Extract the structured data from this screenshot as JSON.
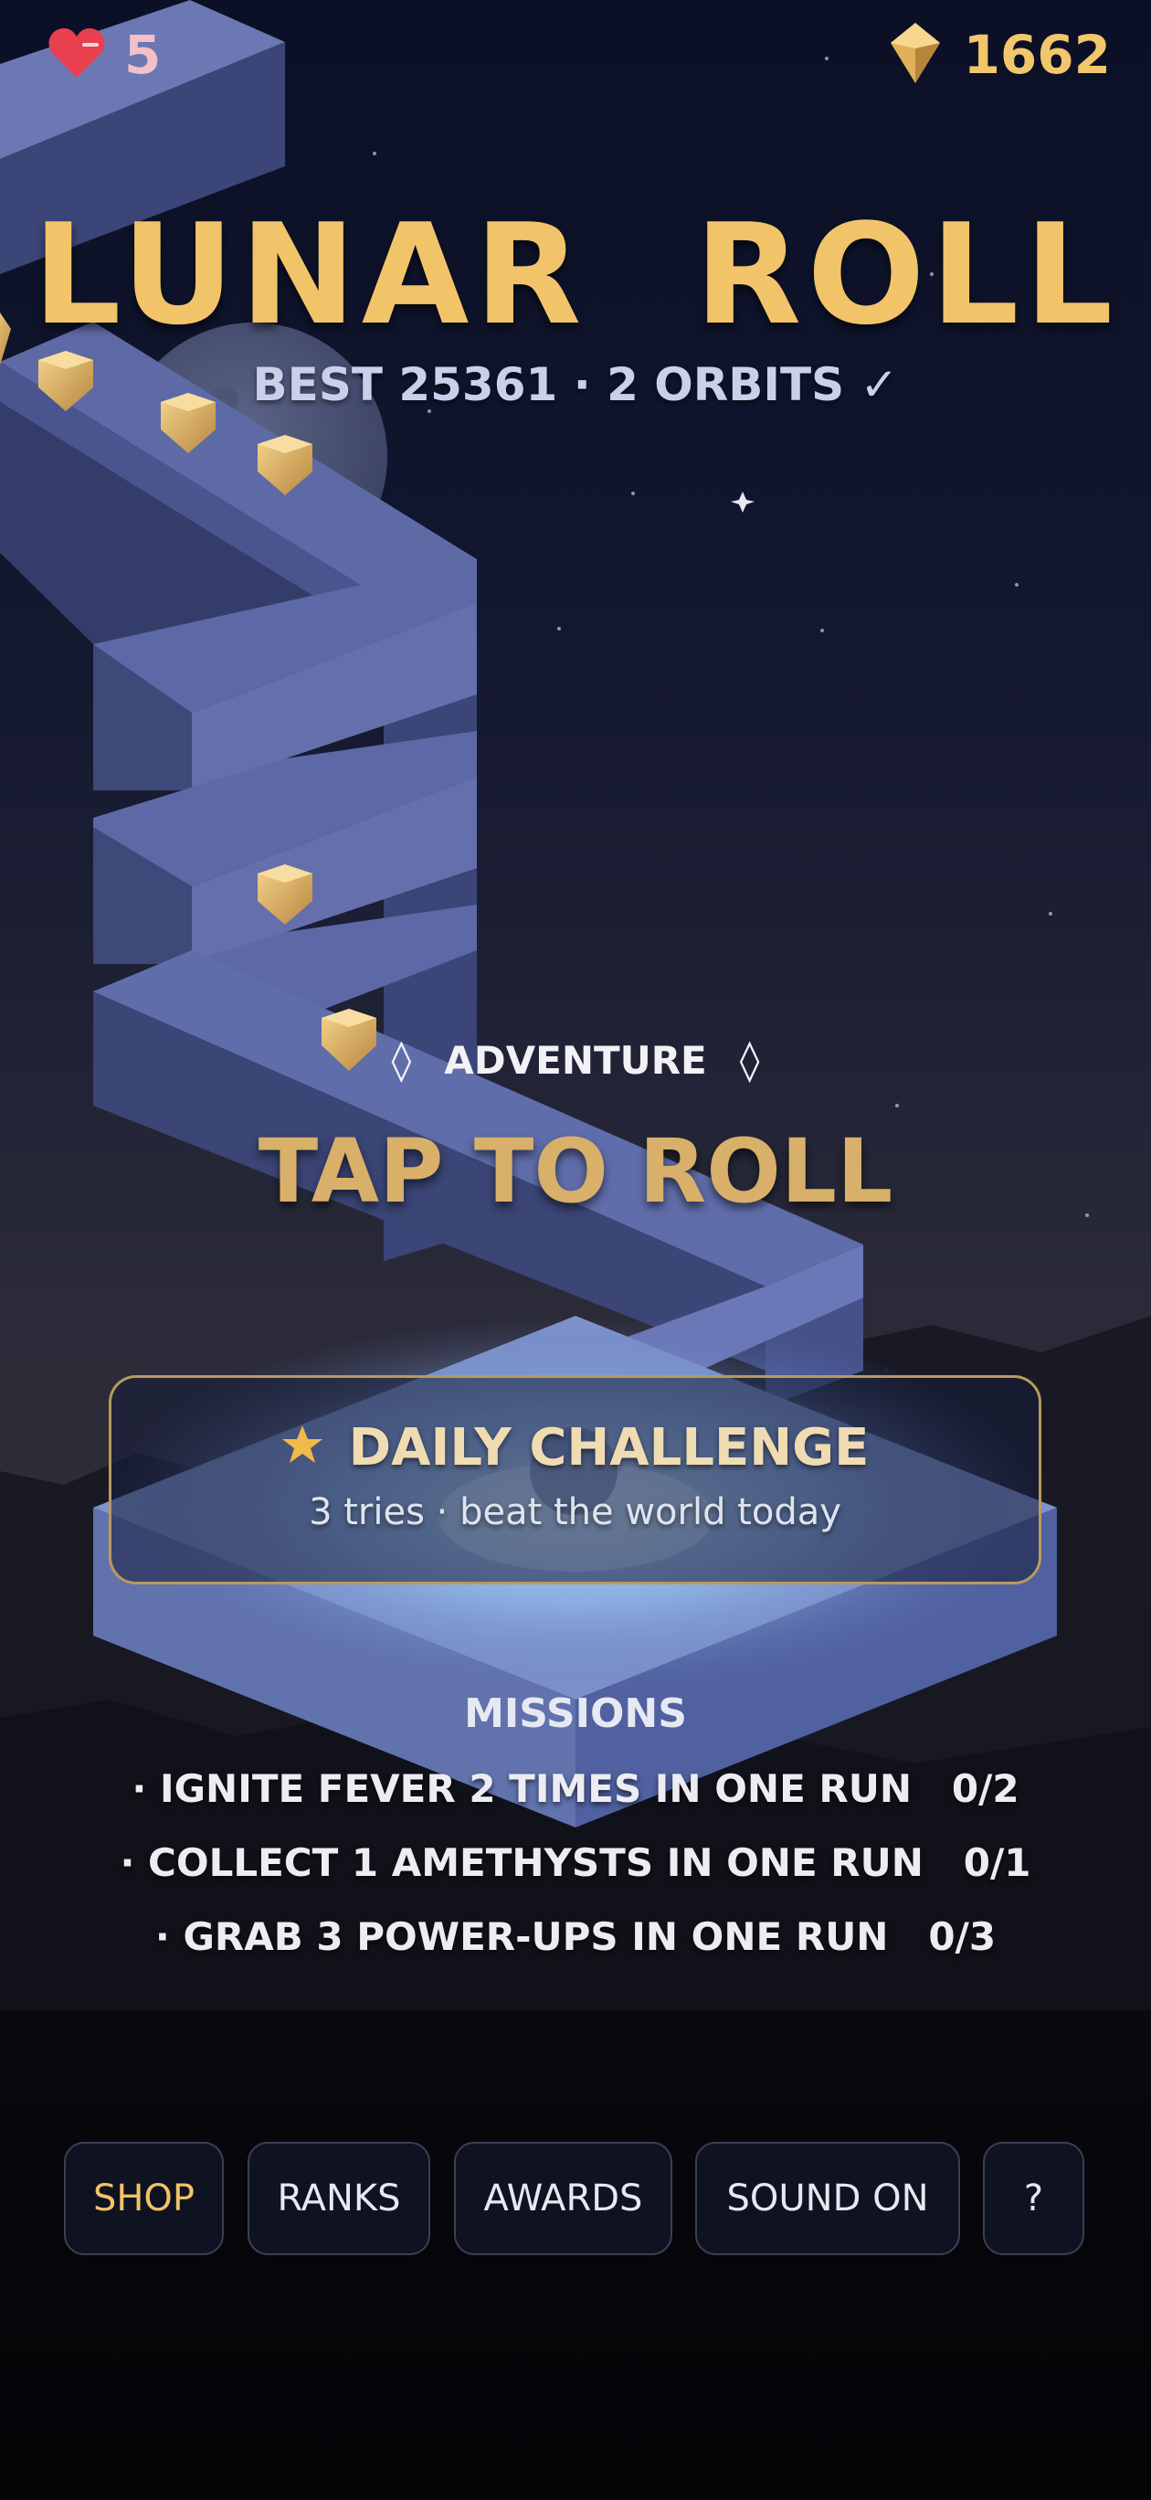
{
  "hud": {
    "lives": "5",
    "gems": "1662",
    "heart_icon": "heart-icon",
    "gem_icon": "gem-icon"
  },
  "title": "LUNAR  ROLL",
  "subtitle": "BEST 25361  ·  2 ORBITS ✓",
  "mode": {
    "label": "ADVENTURE",
    "left_icon": "diamond-outline-icon",
    "right_icon": "diamond-outline-icon"
  },
  "prompt": "TAP TO ROLL",
  "daily_challenge": {
    "title": "DAILY CHALLENGE",
    "subtitle": "3 tries · beat the world today",
    "icon": "star-icon"
  },
  "missions": {
    "title": "MISSIONS",
    "items": [
      "· IGNITE FEVER 2 TIMES IN ONE RUN   0/2",
      "· COLLECT 1 AMETHYSTS IN ONE RUN   0/1",
      "· GRAB 3 POWER-UPS IN ONE RUN   0/3"
    ]
  },
  "buttons": {
    "shop": "SHOP",
    "ranks": "RANKS",
    "awards": "AWARDS",
    "sound": "SOUND ON",
    "help": "?"
  },
  "colors": {
    "accent_gold": "#f2c46a",
    "path_blue": "#5a68a6",
    "background_night": "#0b1026"
  }
}
